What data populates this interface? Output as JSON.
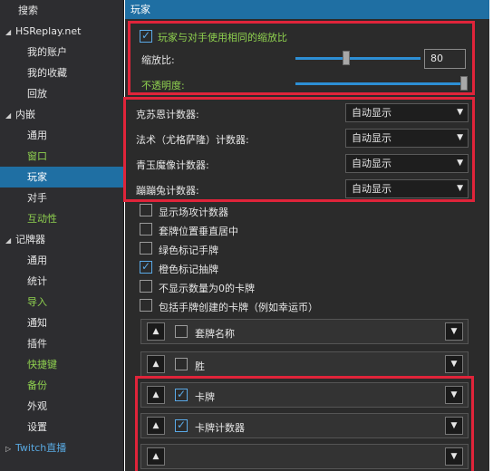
{
  "sidebar": {
    "items": [
      {
        "label": "搜索",
        "level": "top"
      },
      {
        "label": "HSReplay.net",
        "level": "group"
      },
      {
        "label": "我的账户",
        "level": "sub"
      },
      {
        "label": "我的收藏",
        "level": "sub"
      },
      {
        "label": "回放",
        "level": "sub"
      },
      {
        "label": "内嵌",
        "level": "group"
      },
      {
        "label": "通用",
        "level": "sub"
      },
      {
        "label": "窗口",
        "level": "sub",
        "color": "green"
      },
      {
        "label": "玩家",
        "level": "sub",
        "selected": true
      },
      {
        "label": "对手",
        "level": "sub"
      },
      {
        "label": "互动性",
        "level": "sub",
        "color": "green"
      },
      {
        "label": "记牌器",
        "level": "group"
      },
      {
        "label": "通用",
        "level": "sub"
      },
      {
        "label": "统计",
        "level": "sub"
      },
      {
        "label": "导入",
        "level": "sub",
        "color": "green"
      },
      {
        "label": "通知",
        "level": "sub"
      },
      {
        "label": "插件",
        "level": "sub"
      },
      {
        "label": "快捷键",
        "level": "sub",
        "color": "green"
      },
      {
        "label": "备份",
        "level": "sub",
        "color": "green"
      },
      {
        "label": "外观",
        "level": "sub"
      },
      {
        "label": "设置",
        "level": "sub"
      },
      {
        "label": "Twitch直播",
        "level": "group",
        "color": "twitch"
      }
    ]
  },
  "panel": {
    "title": "玩家",
    "scale": {
      "same_scale_label": "玩家与对手使用相同的缩放比",
      "same_scale_checked": true,
      "scale_label": "缩放比:",
      "scale_value": "80",
      "scale_fraction": 0.4,
      "opacity_label": "不透明度:",
      "opacity_fraction": 1.0
    },
    "counters": [
      {
        "label": "克苏恩计数器:",
        "value": "自动显示"
      },
      {
        "label": "法术（尤格萨隆）计数器:",
        "value": "自动显示"
      },
      {
        "label": "青玉魔像计数器:",
        "value": "自动显示"
      },
      {
        "label": "蹦蹦兔计数器:",
        "value": "自动显示"
      }
    ],
    "options": [
      {
        "label": "显示场攻计数器",
        "checked": false
      },
      {
        "label": "套牌位置垂直居中",
        "checked": false
      },
      {
        "label": "绿色标记手牌",
        "checked": false
      },
      {
        "label": "橙色标记抽牌",
        "checked": true
      },
      {
        "label": "不显示数量为0的卡牌",
        "checked": false
      },
      {
        "label": "包括手牌创建的卡牌（例如幸运币）",
        "checked": false
      }
    ],
    "order_rows": [
      {
        "label": "套牌名称",
        "checked": false
      },
      {
        "label": "胜",
        "checked": false
      },
      {
        "label": "卡牌",
        "checked": true
      },
      {
        "label": "卡牌计数器",
        "checked": true
      }
    ]
  },
  "colors": {
    "accent": "#1f6fa3",
    "highlight": "#e0243a",
    "green_text": "#8fd14f"
  }
}
